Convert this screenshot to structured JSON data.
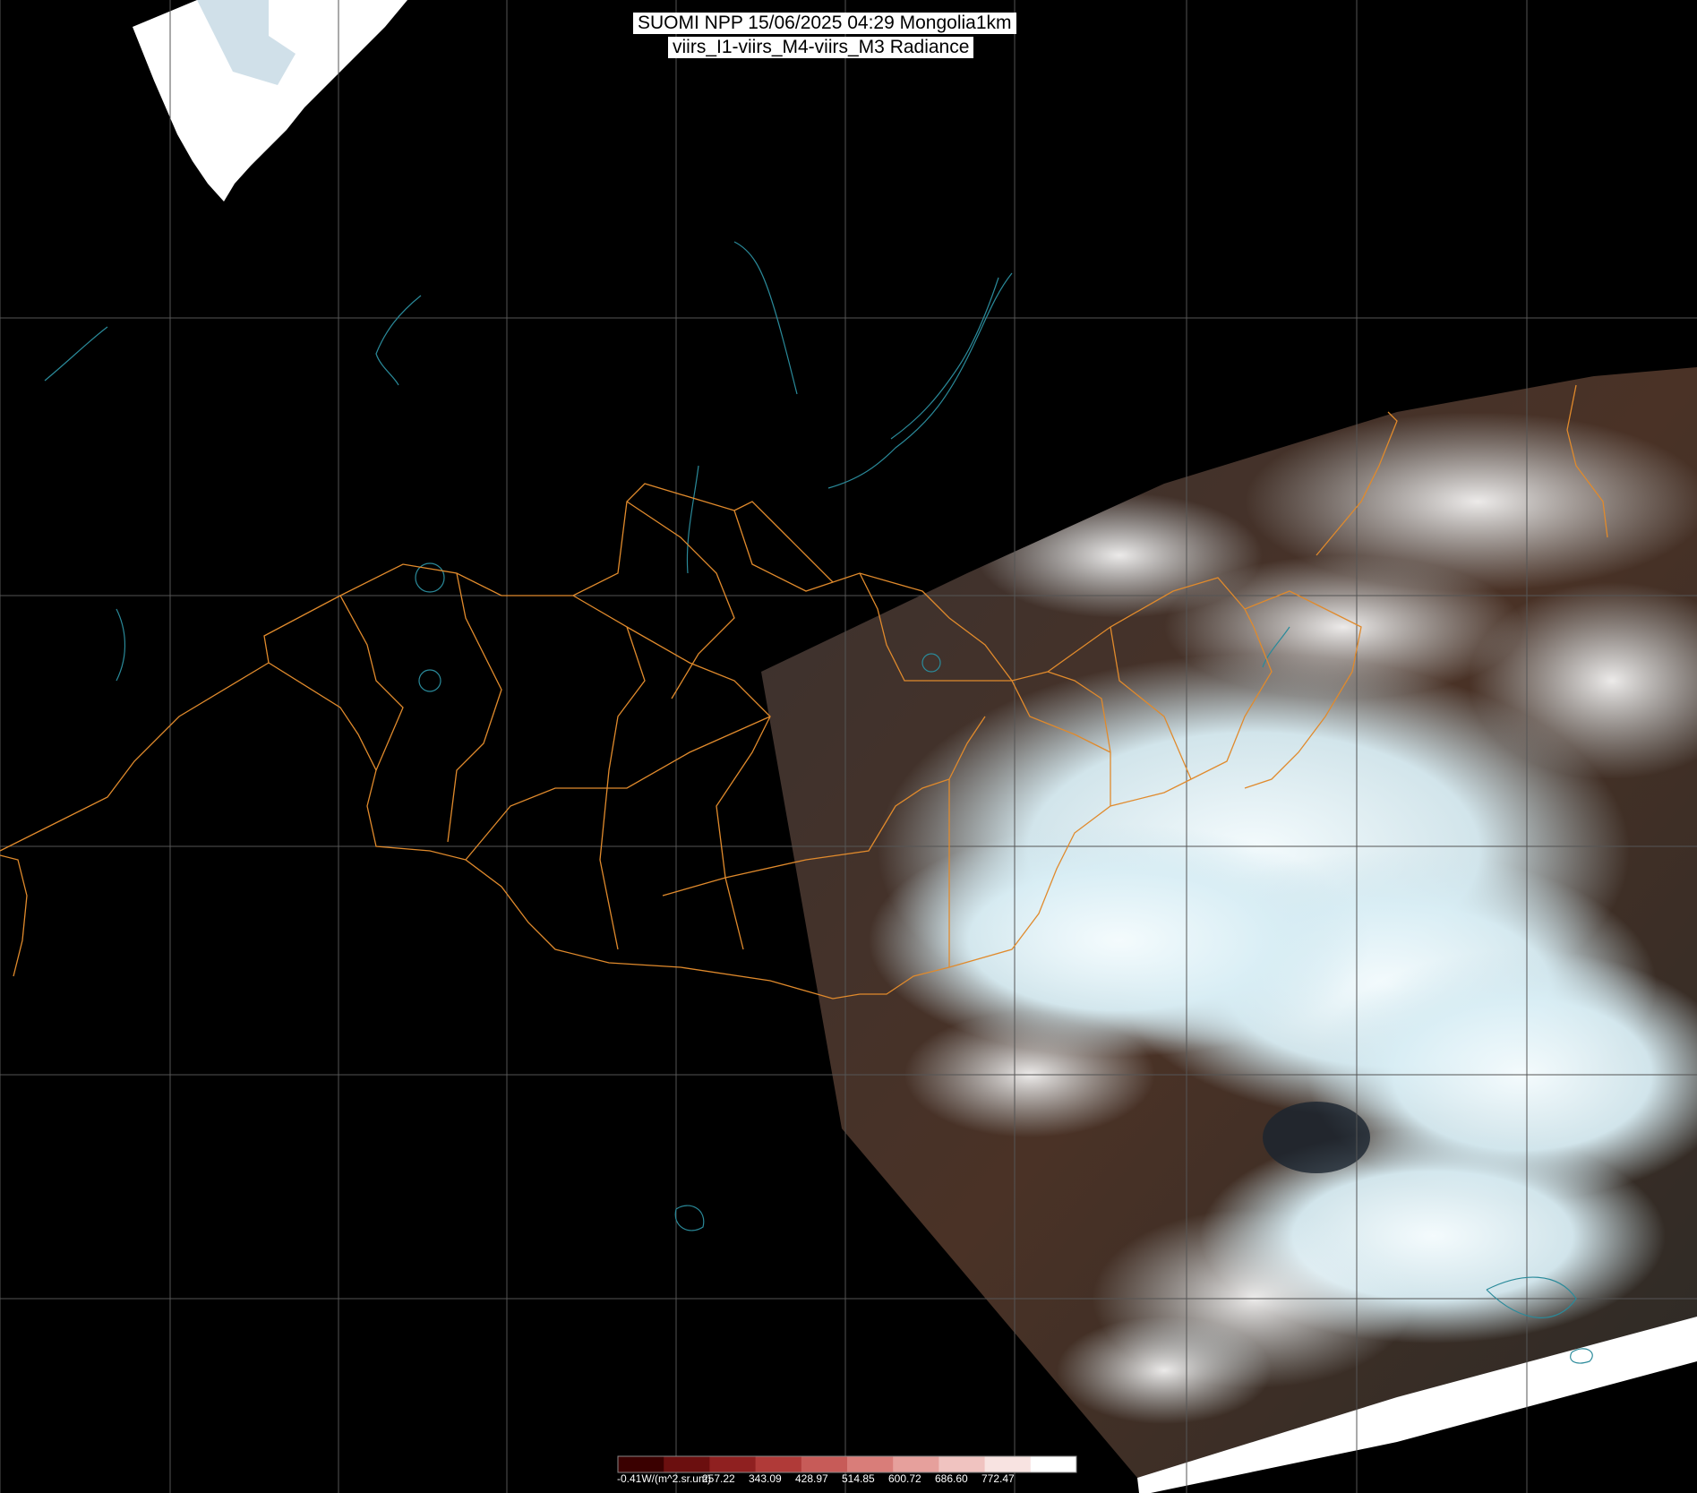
{
  "header": {
    "title_line1": "SUOMI NPP 15/06/2025 04:29 Mongolia1km",
    "title_line2": "viirs_I1-viirs_M4-viirs_M3 Radiance"
  },
  "colorbar": {
    "unit_label": "-0.41W/(m^2.sr.um)",
    "tick_labels": [
      "257.22",
      "343.09",
      "428.97",
      "514.85",
      "600.72",
      "686.60",
      "772.47"
    ],
    "colors": [
      "#3a0000",
      "#6b0f0f",
      "#8f2020",
      "#b03a38",
      "#c75b58",
      "#d97d79",
      "#e6a09c",
      "#f0c3c0",
      "#f8e3e1",
      "#ffffff"
    ]
  },
  "colors": {
    "background": "#000000",
    "grid": "#555555",
    "admin_borders": "#e08a2c",
    "coastline_water": "#2a8a9a",
    "cloud": "#e8f6fb",
    "land": "#3d2a22"
  }
}
